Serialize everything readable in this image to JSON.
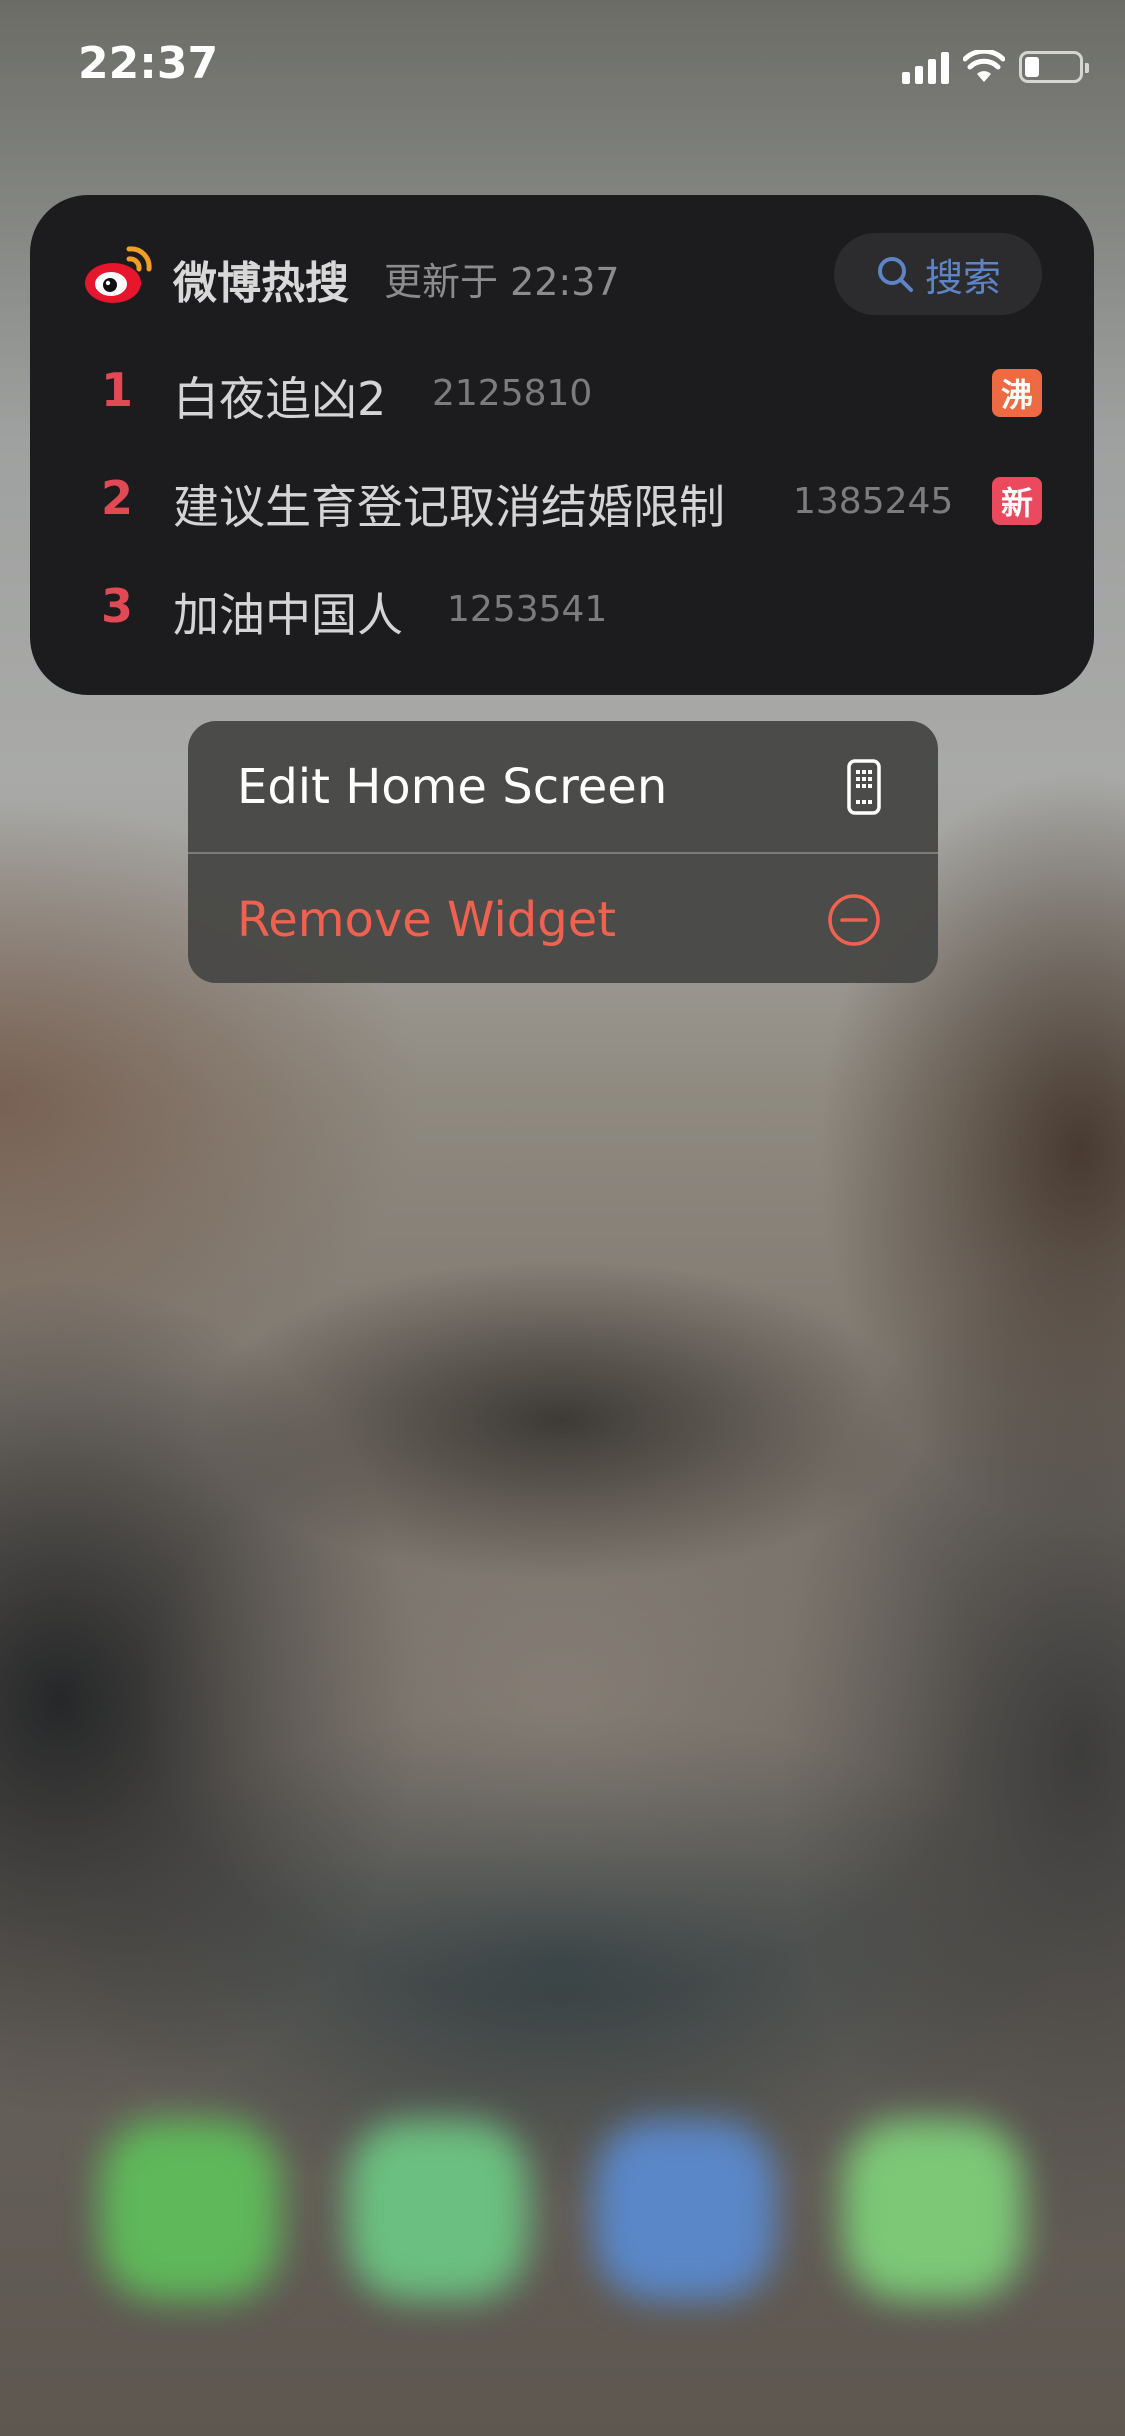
{
  "status_bar": {
    "time": "22:37",
    "icons": [
      "cellular-signal-icon",
      "wifi-icon",
      "battery-icon"
    ]
  },
  "widget": {
    "app_icon": "weibo-logo",
    "title": "微博热搜",
    "updated": "更新于 22:37",
    "search_label": "搜索",
    "rank_color": "#e04a55",
    "items": [
      {
        "rank": "1",
        "topic": "白夜追凶2",
        "count": "2125810",
        "badge": "沸",
        "badge_color": "#ee6a42"
      },
      {
        "rank": "2",
        "topic": "建议生育登记取消结婚限制",
        "count": "1385245",
        "badge": "新",
        "badge_color": "#eb4a5e"
      },
      {
        "rank": "3",
        "topic": "加油中国人",
        "count": "1253541",
        "badge": "",
        "badge_color": ""
      }
    ]
  },
  "context_menu": {
    "items": [
      {
        "label": "Edit Home Screen",
        "icon": "phone-apps-icon",
        "color": "#ffffff"
      },
      {
        "label": "Remove Widget",
        "icon": "minus-circle-icon",
        "color": "#f0624f"
      }
    ]
  },
  "dock": {
    "icons": [
      "phone-app-icon",
      "wechat-app-icon",
      "safari-app-icon",
      "messages-app-icon"
    ]
  }
}
